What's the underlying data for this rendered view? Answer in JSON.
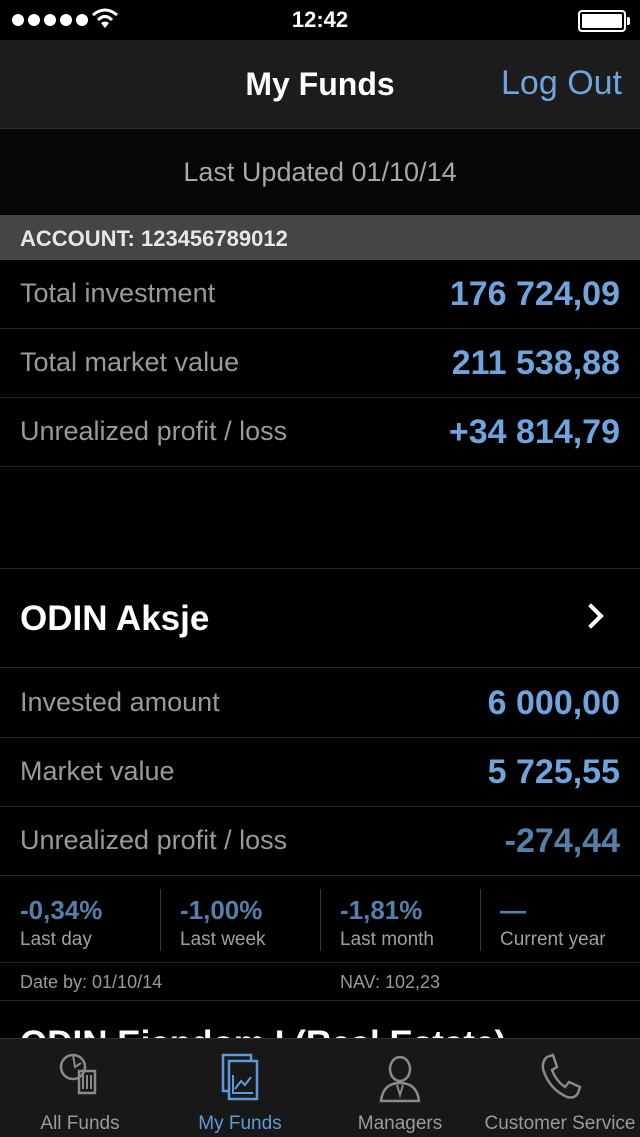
{
  "status_bar": {
    "time": "12:42"
  },
  "nav": {
    "title": "My Funds",
    "logout_label": "Log Out"
  },
  "last_updated": "Last Updated 01/10/14",
  "account": {
    "header": "ACCOUNT: 123456789012",
    "rows": [
      {
        "label": "Total investment",
        "value": "176 724,09"
      },
      {
        "label": "Total market value",
        "value": "211 538,88"
      },
      {
        "label": "Unrealized profit / loss",
        "value": "+34 814,79"
      }
    ]
  },
  "fund": {
    "name": "ODIN Aksje",
    "rows": [
      {
        "label": "Invested amount",
        "value": "6 000,00"
      },
      {
        "label": "Market value",
        "value": "5 725,55"
      },
      {
        "label": "Unrealized profit / loss",
        "value": "-274,44"
      }
    ],
    "performance": [
      {
        "value": "-0,34%",
        "label": "Last day"
      },
      {
        "value": "-1,00%",
        "label": "Last week"
      },
      {
        "value": "-1,81%",
        "label": "Last month"
      },
      {
        "value": "—",
        "label": "Current year"
      }
    ],
    "date_by": "Date by: 01/10/14",
    "nav": "NAV: 102,23"
  },
  "next_fund_peek": "ODIN Eiendom I (Real Estate)",
  "tabs": [
    {
      "label": "All Funds",
      "icon": "all-funds-icon"
    },
    {
      "label": "My Funds",
      "icon": "my-funds-chart-icon",
      "active": true
    },
    {
      "label": "Managers",
      "icon": "manager-person-icon"
    },
    {
      "label": "Customer Service",
      "icon": "phone-icon"
    }
  ],
  "colors": {
    "accent": "#6fa4dc",
    "negative": "#557ea8",
    "background": "#000000",
    "tab_active": "#5f9ad6"
  }
}
